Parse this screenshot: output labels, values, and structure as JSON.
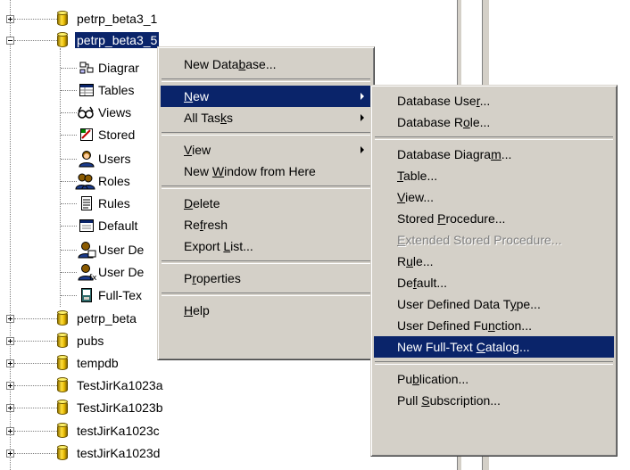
{
  "tree": {
    "databases_top": [
      {
        "label": "petrp_beta3_1"
      },
      {
        "label": "petrp_beta3_5"
      }
    ],
    "children": [
      {
        "label": "Diagrar",
        "icon": "diagram-icon"
      },
      {
        "label": "Tables",
        "icon": "tables-icon"
      },
      {
        "label": "Views",
        "icon": "views-icon"
      },
      {
        "label": "Stored",
        "icon": "stored-procedures-icon"
      },
      {
        "label": "Users",
        "icon": "users-icon"
      },
      {
        "label": "Roles",
        "icon": "roles-icon"
      },
      {
        "label": "Rules",
        "icon": "rules-icon"
      },
      {
        "label": "Default",
        "icon": "defaults-icon"
      },
      {
        "label": "User De",
        "icon": "user-defined-data-types-icon"
      },
      {
        "label": "User De",
        "icon": "user-defined-functions-icon"
      },
      {
        "label": "Full-Tex",
        "icon": "full-text-catalogs-icon"
      }
    ],
    "databases_bottom": [
      {
        "label": "petrp_beta"
      },
      {
        "label": "pubs"
      },
      {
        "label": "tempdb"
      },
      {
        "label": "TestJirKa1023a"
      },
      {
        "label": "TestJirKa1023b"
      },
      {
        "label": "testJirKa1023c"
      },
      {
        "label": "testJirKa1023d"
      }
    ]
  },
  "context_menu": {
    "new_database": {
      "pre": "New Data",
      "u": "b",
      "post": "ase..."
    },
    "new": {
      "pre": "",
      "u": "N",
      "post": "ew"
    },
    "all_tasks": {
      "pre": "All Tas",
      "u": "k",
      "post": "s"
    },
    "view": {
      "pre": "",
      "u": "V",
      "post": "iew"
    },
    "new_window": {
      "pre": "New ",
      "u": "W",
      "post": "indow from Here"
    },
    "delete": {
      "pre": "",
      "u": "D",
      "post": "elete"
    },
    "refresh": {
      "pre": "Re",
      "u": "f",
      "post": "resh"
    },
    "export_list": {
      "pre": "Export ",
      "u": "L",
      "post": "ist..."
    },
    "properties": {
      "pre": "P",
      "u": "r",
      "post": "operties"
    },
    "help": {
      "pre": "",
      "u": "H",
      "post": "elp"
    }
  },
  "submenu": {
    "database_user": {
      "pre": "Database Use",
      "u": "r",
      "post": "..."
    },
    "database_role": {
      "pre": "Database R",
      "u": "o",
      "post": "le..."
    },
    "database_diagram": {
      "pre": "Database Diagra",
      "u": "m",
      "post": "..."
    },
    "table": {
      "pre": "",
      "u": "T",
      "post": "able..."
    },
    "view": {
      "pre": "",
      "u": "V",
      "post": "iew..."
    },
    "stored_procedure": {
      "pre": "Stored ",
      "u": "P",
      "post": "rocedure..."
    },
    "extended_stored_procedure": {
      "pre": "",
      "u": "E",
      "post": "xtended Stored Procedure..."
    },
    "rule": {
      "pre": "R",
      "u": "u",
      "post": "le..."
    },
    "default": {
      "pre": "De",
      "u": "f",
      "post": "ault..."
    },
    "user_defined_data_type": {
      "pre": "User Defined Data T",
      "u": "y",
      "post": "pe..."
    },
    "user_defined_function": {
      "pre": "User Defined Fu",
      "u": "n",
      "post": "ction..."
    },
    "new_full_text_catalog": {
      "pre": "New Full-Text ",
      "u": "C",
      "post": "atalog..."
    },
    "publication": {
      "pre": "Pu",
      "u": "b",
      "post": "lication..."
    },
    "pull_subscription": {
      "pre": "Pull ",
      "u": "S",
      "post": "ubscription..."
    }
  }
}
